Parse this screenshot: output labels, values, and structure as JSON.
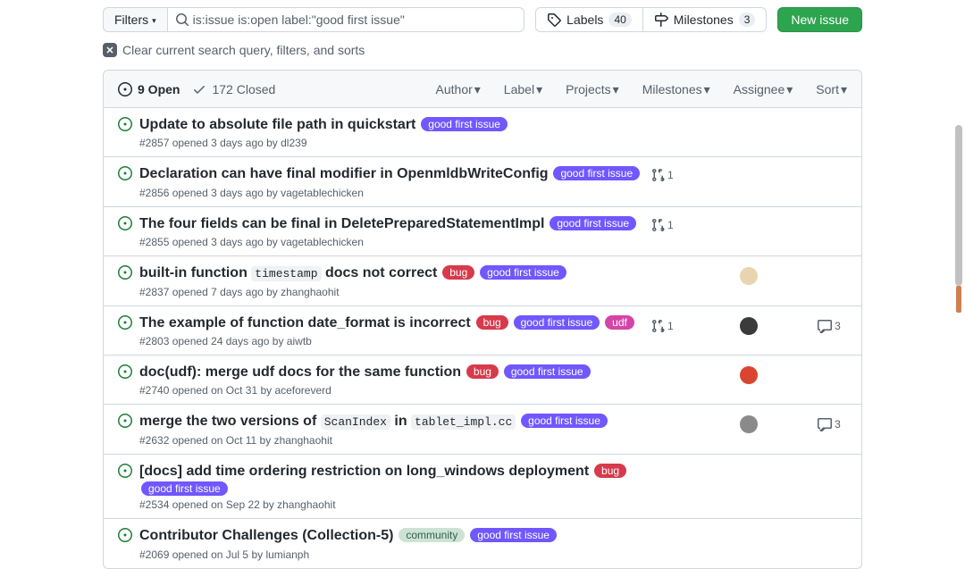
{
  "filters_label": "Filters",
  "search_value": "is:issue is:open label:\"good first issue\"",
  "labels_btn": {
    "label": "Labels",
    "count": "40"
  },
  "milestones_btn": {
    "label": "Milestones",
    "count": "3"
  },
  "new_issue_label": "New issue",
  "clear_label": "Clear current search query, filters, and sorts",
  "open_count": "9 Open",
  "closed_count": "172 Closed",
  "toolbar": {
    "author": "Author",
    "label": "Label",
    "projects": "Projects",
    "milestones": "Milestones",
    "assignee": "Assignee",
    "sort": "Sort"
  },
  "label_colors": {
    "good_first_issue": "#7057ff",
    "bug": "#d73a4a",
    "udf": "#d544a6",
    "community": "#cde3d2",
    "community_text": "#33614a"
  },
  "issues": [
    {
      "title_parts": [
        {
          "text": "Update to absolute file path in quickstart"
        }
      ],
      "labels": [
        {
          "name": "good first issue",
          "color": "good_first_issue"
        }
      ],
      "meta": "#2857 opened 3 days ago by dl239",
      "pr": "",
      "assignee": "",
      "comments": ""
    },
    {
      "title_parts": [
        {
          "text": "Declaration can have final modifier in OpenmldbWriteConfig"
        }
      ],
      "labels": [
        {
          "name": "good first issue",
          "color": "good_first_issue"
        }
      ],
      "meta": "#2856 opened 3 days ago by vagetablechicken",
      "pr": "1",
      "assignee": "",
      "comments": ""
    },
    {
      "title_parts": [
        {
          "text": "The four fields can be final in DeletePreparedStatementImpl"
        }
      ],
      "labels": [
        {
          "name": "good first issue",
          "color": "good_first_issue"
        }
      ],
      "meta": "#2855 opened 3 days ago by vagetablechicken",
      "pr": "1",
      "assignee": "",
      "comments": ""
    },
    {
      "title_parts": [
        {
          "text": "built-in function "
        },
        {
          "code": "timestamp"
        },
        {
          "text": " docs not correct"
        }
      ],
      "labels": [
        {
          "name": "bug",
          "color": "bug"
        },
        {
          "name": "good first issue",
          "color": "good_first_issue"
        }
      ],
      "meta": "#2837 opened 7 days ago by zhanghaohit",
      "pr": "",
      "assignee_color": "#e8d5b0",
      "comments": ""
    },
    {
      "title_parts": [
        {
          "text": "The example of function date_format is incorrect"
        }
      ],
      "labels": [
        {
          "name": "bug",
          "color": "bug"
        },
        {
          "name": "good first issue",
          "color": "good_first_issue"
        },
        {
          "name": "udf",
          "color": "udf"
        }
      ],
      "meta": "#2803 opened 24 days ago by aiwtb",
      "pr": "1",
      "assignee_color": "#3b3b3b",
      "comments": "3"
    },
    {
      "title_parts": [
        {
          "text": "doc(udf): merge udf docs for the same function"
        }
      ],
      "labels": [
        {
          "name": "bug",
          "color": "bug"
        },
        {
          "name": "good first issue",
          "color": "good_first_issue"
        }
      ],
      "meta": "#2740 opened on Oct 31 by aceforeverd",
      "pr": "",
      "assignee_color": "#d9452e",
      "comments": ""
    },
    {
      "title_parts": [
        {
          "text": "merge the two versions of "
        },
        {
          "code": "ScanIndex"
        },
        {
          "text": " in "
        },
        {
          "code": "tablet_impl.cc"
        }
      ],
      "labels": [
        {
          "name": "good first issue",
          "color": "good_first_issue"
        }
      ],
      "meta": "#2632 opened on Oct 11 by zhanghaohit",
      "pr": "",
      "assignee_color": "#8a8a8a",
      "comments": "3"
    },
    {
      "title_parts": [
        {
          "text": "[docs] add time ordering restriction on long_windows deployment"
        }
      ],
      "labels": [
        {
          "name": "bug",
          "color": "bug"
        },
        {
          "name": "good first issue",
          "color": "good_first_issue"
        }
      ],
      "meta": "#2534 opened on Sep 22 by zhanghaohit",
      "pr": "",
      "assignee": "",
      "comments": ""
    },
    {
      "title_parts": [
        {
          "text": "Contributor Challenges (Collection-5)"
        }
      ],
      "labels": [
        {
          "name": "community",
          "color": "community",
          "text_color": "community_text"
        },
        {
          "name": "good first issue",
          "color": "good_first_issue"
        }
      ],
      "meta": "#2069 opened on Jul 5 by lumianph",
      "pr": "",
      "assignee": "",
      "comments": ""
    }
  ]
}
